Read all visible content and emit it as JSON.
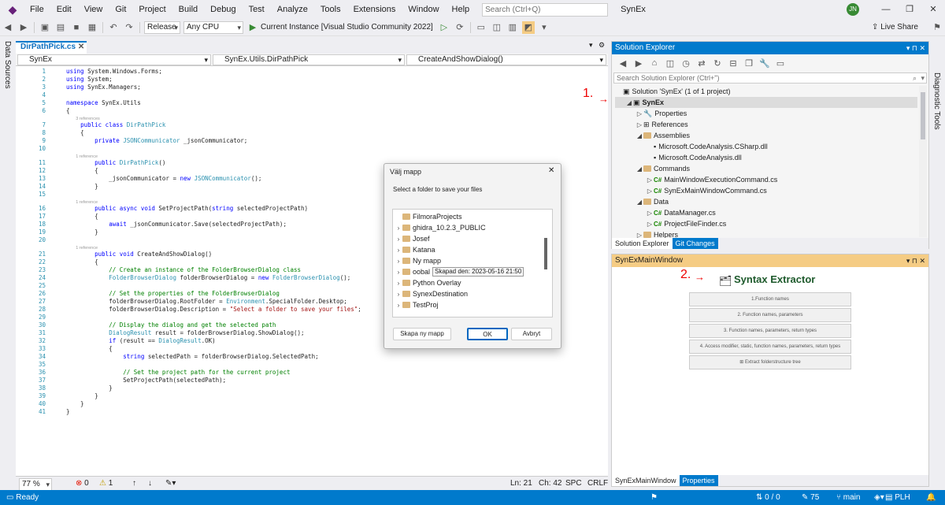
{
  "menu": {
    "items": [
      "File",
      "Edit",
      "View",
      "Git",
      "Project",
      "Build",
      "Debug",
      "Test",
      "Analyze",
      "Tools",
      "Extensions",
      "Window",
      "Help"
    ],
    "search_placeholder": "Search (Ctrl+Q)",
    "solution_name": "SynEx",
    "avatar": "JN",
    "live_share": "Live Share"
  },
  "toolbar": {
    "config": "Release",
    "platform": "Any CPU",
    "run_label": "Current Instance [Visual Studio Community 2022]"
  },
  "sidebars": {
    "left": "Data Sources",
    "right": "Diagnostic Tools"
  },
  "editor": {
    "tab": "DirPathPick.cs",
    "nav": [
      "SynEx",
      "SynEx.Utils.DirPathPick",
      "CreateAndShowDialog()"
    ],
    "lines": [
      {
        "n": "1",
        "t": "using System.Windows.Forms;"
      },
      {
        "n": "2",
        "t": "using System;"
      },
      {
        "n": "3",
        "t": "using SynEx.Managers;"
      },
      {
        "n": "4",
        "t": ""
      },
      {
        "n": "5",
        "t": "namespace SynEx.Utils"
      },
      {
        "n": "6",
        "t": "{"
      },
      {
        "n": "",
        "t": "        3 references",
        "ref": true
      },
      {
        "n": "7",
        "t": "    public class DirPathPick"
      },
      {
        "n": "8",
        "t": "    {"
      },
      {
        "n": "9",
        "t": "        private JSONCommunicator _jsonCommunicator;"
      },
      {
        "n": "10",
        "t": ""
      },
      {
        "n": "",
        "t": "        1 reference",
        "ref": true
      },
      {
        "n": "11",
        "t": "        public DirPathPick()"
      },
      {
        "n": "12",
        "t": "        {"
      },
      {
        "n": "13",
        "t": "            _jsonCommunicator = new JSONCommunicator();"
      },
      {
        "n": "14",
        "t": "        }"
      },
      {
        "n": "15",
        "t": ""
      },
      {
        "n": "",
        "t": "        1 reference",
        "ref": true
      },
      {
        "n": "16",
        "t": "        public async void SetProjectPath(string selectedProjectPath)"
      },
      {
        "n": "17",
        "t": "        {"
      },
      {
        "n": "18",
        "t": "            await _jsonCommunicator.Save(selectedProjectPath);"
      },
      {
        "n": "19",
        "t": "        }"
      },
      {
        "n": "20",
        "t": ""
      },
      {
        "n": "",
        "t": "        1 reference",
        "ref": true
      },
      {
        "n": "21",
        "t": "        public void CreateAndShowDialog()"
      },
      {
        "n": "22",
        "t": "        {"
      },
      {
        "n": "23",
        "t": "            // Create an instance of the FolderBrowserDialog class"
      },
      {
        "n": "24",
        "t": "            FolderBrowserDialog folderBrowserDialog = new FolderBrowserDialog();"
      },
      {
        "n": "25",
        "t": ""
      },
      {
        "n": "26",
        "t": "            // Set the properties of the FolderBrowserDialog"
      },
      {
        "n": "27",
        "t": "            folderBrowserDialog.RootFolder = Environment.SpecialFolder.Desktop;"
      },
      {
        "n": "28",
        "t": "            folderBrowserDialog.Description = \"Select a folder to save your files\";"
      },
      {
        "n": "29",
        "t": ""
      },
      {
        "n": "30",
        "t": "            // Display the dialog and get the selected path"
      },
      {
        "n": "31",
        "t": "            DialogResult result = folderBrowserDialog.ShowDialog();"
      },
      {
        "n": "32",
        "t": "            if (result == DialogResult.OK)"
      },
      {
        "n": "33",
        "t": "            {"
      },
      {
        "n": "34",
        "t": "                string selectedPath = folderBrowserDialog.SelectedPath;"
      },
      {
        "n": "35",
        "t": ""
      },
      {
        "n": "36",
        "t": "                // Set the project path for the current project"
      },
      {
        "n": "37",
        "t": "                SetProjectPath(selectedPath);"
      },
      {
        "n": "38",
        "t": "            }"
      },
      {
        "n": "39",
        "t": "        }"
      },
      {
        "n": "40",
        "t": "    }"
      },
      {
        "n": "41",
        "t": "}"
      }
    ],
    "status": {
      "zoom": "77 %",
      "errors": "0",
      "warnings": "1",
      "line": "Ln: 21",
      "col": "Ch: 42",
      "spc": "SPC",
      "crlf": "CRLF"
    }
  },
  "solution_explorer": {
    "title": "Solution Explorer",
    "search": "Search Solution Explorer (Ctrl+\")",
    "items": [
      {
        "label": "Solution 'SynEx' (1 of 1 project)",
        "lvl": 0,
        "kind": "sln"
      },
      {
        "label": "SynEx",
        "lvl": 1,
        "kind": "proj",
        "exp": "◢"
      },
      {
        "label": "Properties",
        "lvl": 2,
        "kind": "prop",
        "exp": "▷"
      },
      {
        "label": "References",
        "lvl": 2,
        "kind": "ref",
        "exp": "▷"
      },
      {
        "label": "Assemblies",
        "lvl": 2,
        "kind": "folder",
        "exp": "◢"
      },
      {
        "label": "Microsoft.CodeAnalysis.CSharp.dll",
        "lvl": 3,
        "kind": "dll"
      },
      {
        "label": "Microsoft.CodeAnalysis.dll",
        "lvl": 3,
        "kind": "dll"
      },
      {
        "label": "Commands",
        "lvl": 2,
        "kind": "folder",
        "exp": "◢"
      },
      {
        "label": "MainWindowExecutionCommand.cs",
        "lvl": 3,
        "kind": "cs",
        "exp": "▷"
      },
      {
        "label": "SynExMainWindowCommand.cs",
        "lvl": 3,
        "kind": "cs",
        "exp": "▷"
      },
      {
        "label": "Data",
        "lvl": 2,
        "kind": "folder",
        "exp": "◢"
      },
      {
        "label": "DataManager.cs",
        "lvl": 3,
        "kind": "cs",
        "exp": "▷"
      },
      {
        "label": "ProjectFileFinder.cs",
        "lvl": 3,
        "kind": "cs",
        "exp": "▷"
      },
      {
        "label": "Helpers",
        "lvl": 2,
        "kind": "folder",
        "exp": "▷"
      }
    ],
    "tabs": [
      "Solution Explorer",
      "Git Changes"
    ]
  },
  "annotations": {
    "one": "1.",
    "two": "2."
  },
  "synex": {
    "title": "SynExMainWindow",
    "heading": "Syntax Extractor",
    "options": [
      "1.Function names",
      "2. Function names, parameters",
      "3. Function names, parameters, return types",
      "4. Access modifier, static, function names, parameters, return types",
      "Extract folderstructure tree"
    ],
    "tabs": [
      "SynExMainWindow",
      "Properties"
    ]
  },
  "dialog": {
    "title": "Välj mapp",
    "description": "Select a folder to save your files",
    "folders": [
      "FilmoraProjects",
      "ghidra_10.2.3_PUBLIC",
      "Josef",
      "Katana",
      "Ny mapp",
      "oobal",
      "Python Overlay",
      "SynexDestination",
      "TestProj"
    ],
    "tooltip": "Skapad den: 2023-05-16 21:50",
    "new_folder": "Skapa ny mapp",
    "ok": "OK",
    "cancel": "Avbryt"
  },
  "statusbar": {
    "ready": "Ready",
    "changes": "0 / 0",
    "pencil": "75",
    "branch": "main",
    "lang": "PLH"
  }
}
